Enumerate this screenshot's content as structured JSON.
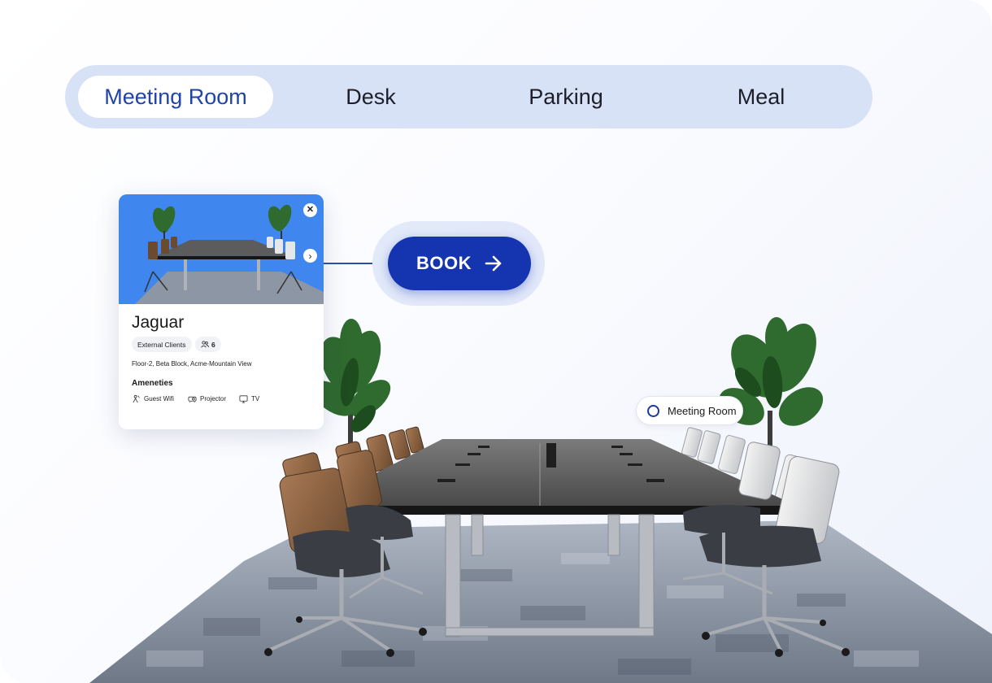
{
  "tabs": [
    {
      "label": "Meeting Room",
      "active": true
    },
    {
      "label": "Desk",
      "active": false
    },
    {
      "label": "Parking",
      "active": false
    },
    {
      "label": "Meal",
      "active": false
    }
  ],
  "card": {
    "title": "Jaguar",
    "tag": "External Clients",
    "capacity": "6",
    "address": "Floor-2, Beta Block, Acme-Mountain View",
    "amenities_title": "Ameneties",
    "amenities": [
      {
        "label": "Guest Wifi",
        "icon": "wifi-user-icon"
      },
      {
        "label": "Projector",
        "icon": "projector-icon"
      },
      {
        "label": "TV",
        "icon": "tv-icon"
      }
    ]
  },
  "book_button": {
    "label": "BOOK"
  },
  "room_pill": {
    "label": "Meeting Room"
  },
  "colors": {
    "accent": "#1535b0",
    "tabbar": "#d8e2f7",
    "active_tab_text": "#1f43a8",
    "photo_bg": "#3f86ee"
  }
}
